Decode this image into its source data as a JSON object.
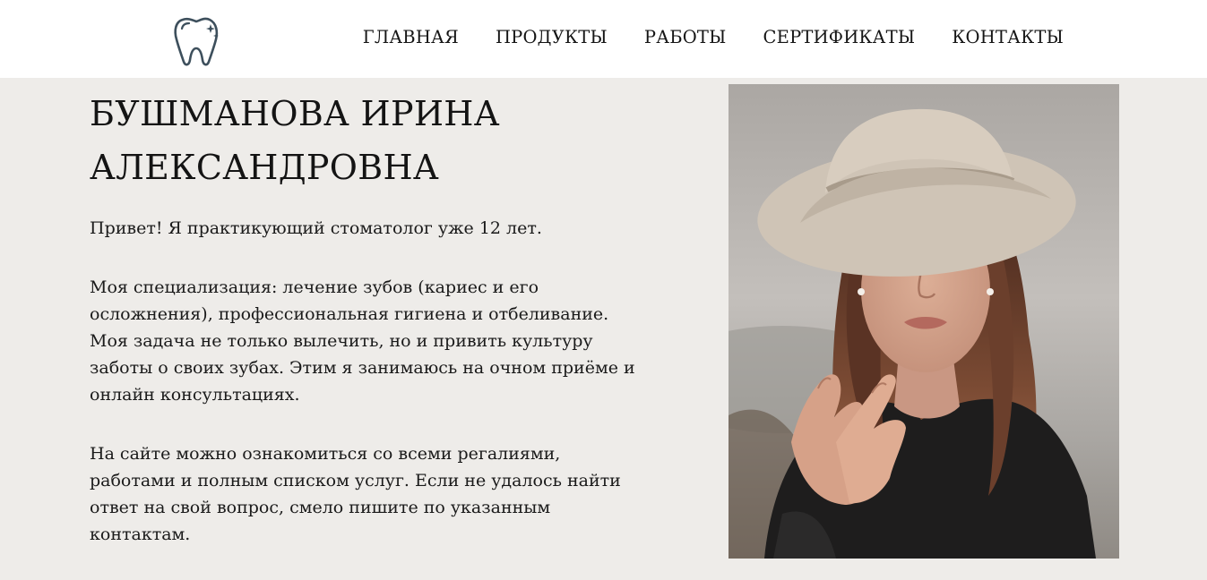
{
  "header": {
    "logo_icon": "tooth-sparkle-icon",
    "nav": [
      {
        "label": "ГЛАВНАЯ"
      },
      {
        "label": "ПРОДУКТЫ"
      },
      {
        "label": "РАБОТЫ"
      },
      {
        "label": "СЕРТИФИКАТЫ"
      },
      {
        "label": "КОНТАКТЫ"
      }
    ]
  },
  "main": {
    "title_lines": [
      "БУШМАНОВА ИРИНА",
      "АЛЕКСАНДРОВНА"
    ],
    "paragraphs": [
      {
        "lines": [
          "Привет! Я практикующий стоматолог уже 12 лет."
        ]
      },
      {
        "lines": [
          "Моя специализация: лечение зубов (кариес и его",
          "осложнения), профессиональная гигиена и отбеливание.",
          "Моя задача не только вылечить, но и привить культуру",
          "заботы о своих зубах. Этим я занимаюсь на очном приёме и",
          "онлайн консультациях."
        ]
      },
      {
        "lines": [
          "На сайте можно ознакомиться со всеми регалиями,",
          "работами и полным списком услуг. Если не удалось найти",
          "ответ на свой вопрос, смело пишите по указанным",
          "контактам."
        ]
      }
    ]
  },
  "colors": {
    "header_bg": "#ffffff",
    "page_bg": "#eeece9",
    "text": "#1b1b1b",
    "logo_stroke": "#3d4f5c"
  }
}
